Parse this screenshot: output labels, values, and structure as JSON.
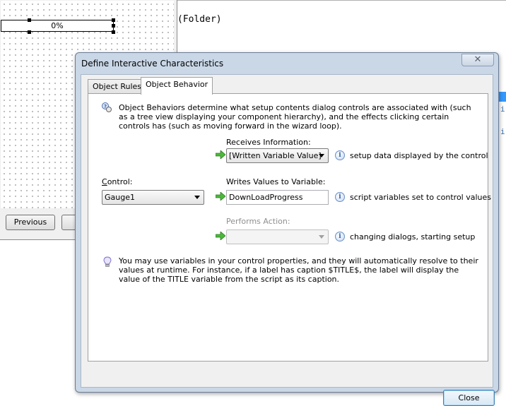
{
  "designer": {
    "gauge_text": "0%",
    "previous_button": "Previous"
  },
  "code_editor": {
    "visible_text": "(Folder)"
  },
  "dialog": {
    "title": "Define Interactive Characteristics",
    "close_glyph": "✕",
    "tabs": [
      {
        "label": "Object Rules",
        "active": false
      },
      {
        "label": "Object Behavior",
        "active": true
      }
    ],
    "intro": "Object Behaviors determine what setup contents dialog controls are associated with (such as a tree view displaying your component hierarchy), and the effects clicking certain controls has (such as moving forward in the wizard loop).",
    "receives": {
      "label": "Receives Information:",
      "value": "[Written Variable Value]",
      "hint": "setup data displayed by the control"
    },
    "control": {
      "label": "Control:",
      "value": "Gauge1"
    },
    "writes": {
      "label": "Writes Values to Variable:",
      "value": "DownLoadProgress",
      "hint": "script variables set to control values"
    },
    "performs": {
      "label": "Performs Action:",
      "value": "",
      "hint": "changing dialogs, starting setup"
    },
    "tip": "You may use variables in your control properties, and they will automatically resolve to their values at runtime. For instance, if a label has caption $TITLE$, the label will display the value of the TITLE variable from the script as its caption.",
    "close_button": "Close"
  },
  "colors": {
    "dialog_frame": "#c9d7e7",
    "arrow_green": "#3aa52a",
    "info_blue": "#2f5da8"
  },
  "icons": [
    "info-icon",
    "green-arrow-icon",
    "lightbulb-icon",
    "behavior-icon"
  ]
}
